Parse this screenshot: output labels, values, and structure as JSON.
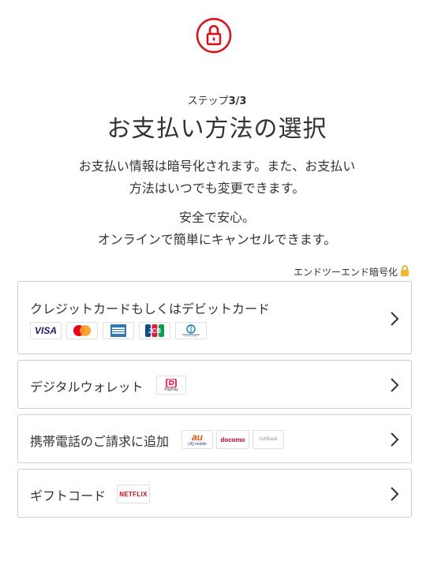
{
  "step": {
    "prefix": "ステップ",
    "value": "3/3"
  },
  "title": "お支払い方法の選択",
  "description": {
    "line1": "お支払い情報は暗号化されます。また、お支払い",
    "line2": "方法はいつでも変更できます。",
    "line3": "安全で安心。",
    "line4": "オンラインで簡単にキャンセルできます。"
  },
  "encryption_label": "エンドツーエンド暗号化",
  "options": [
    {
      "label": "クレジットカードもしくはデビットカード",
      "logos": [
        "VISA",
        "Mastercard",
        "AMEX",
        "JCB",
        "Diners Club"
      ]
    },
    {
      "label": "デジタルウォレット",
      "logos": [
        "PayPay"
      ]
    },
    {
      "label": "携帯電話のご請求に追加",
      "logos": [
        "au UQ mobile",
        "docomo",
        "SoftBank"
      ]
    },
    {
      "label": "ギフトコード",
      "logos": [
        "NETFLIX"
      ]
    }
  ],
  "colors": {
    "accent": "#e50914",
    "border": "#cccccc",
    "text": "#333333"
  },
  "icons": {
    "header": "lock-icon",
    "option_arrow": "chevron-right-icon",
    "encryption": "lock-icon"
  }
}
